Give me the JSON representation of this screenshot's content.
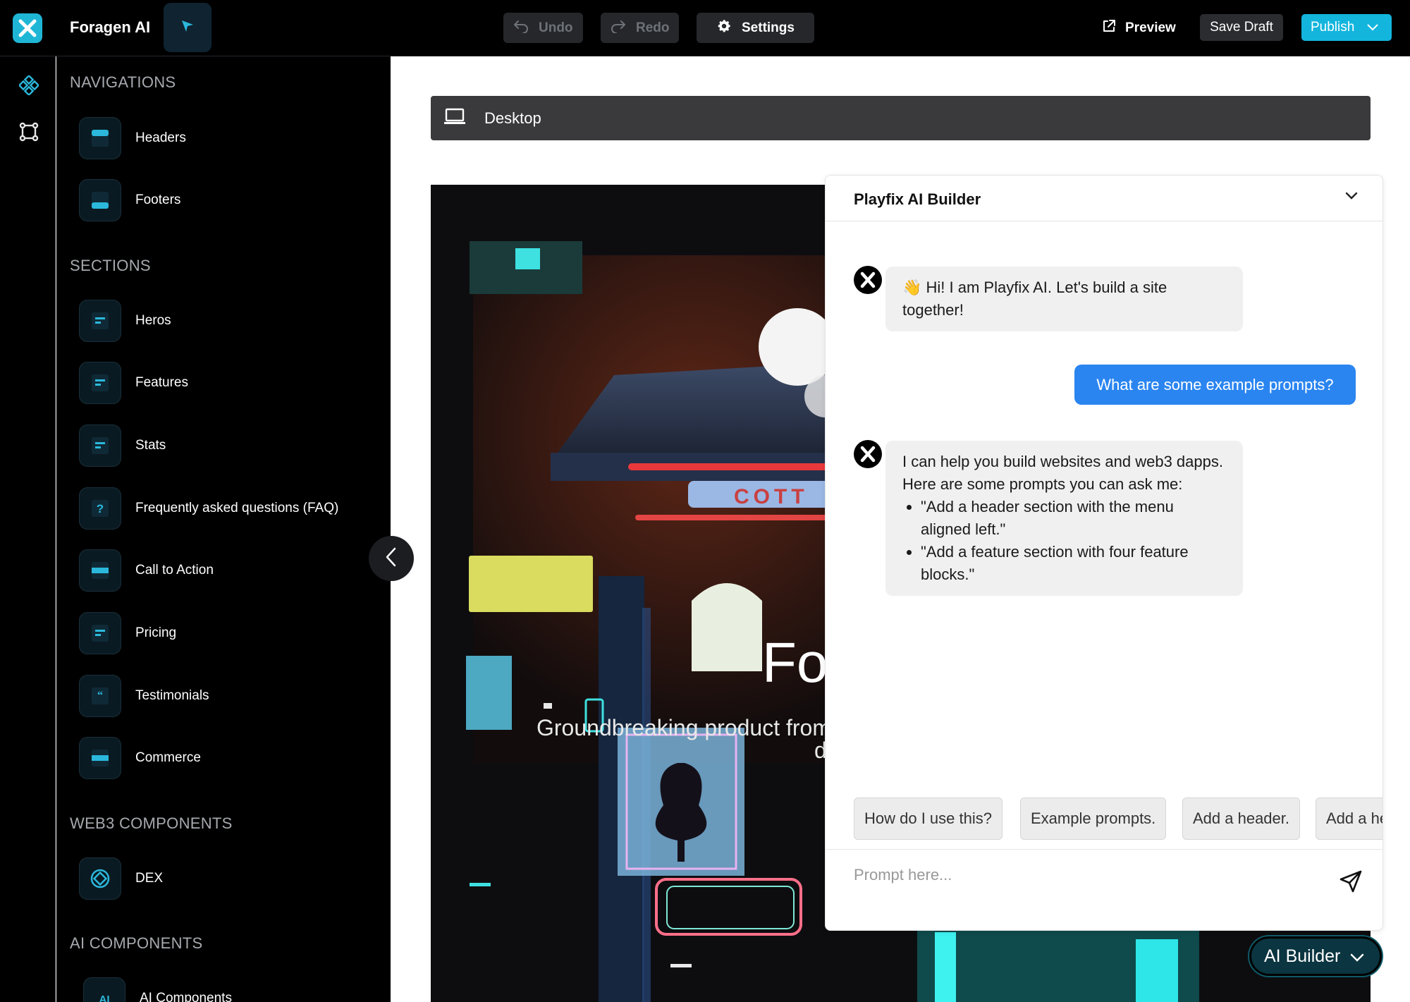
{
  "topbar": {
    "app_title": "Foragen AI",
    "undo_label": "Undo",
    "redo_label": "Redo",
    "settings_label": "Settings",
    "preview_label": "Preview",
    "save_draft_label": "Save Draft",
    "publish_label": "Publish"
  },
  "sidebar": {
    "sections": [
      {
        "title": "NAVIGATIONS",
        "items": [
          {
            "label": "Headers"
          },
          {
            "label": "Footers"
          }
        ]
      },
      {
        "title": "SECTIONS",
        "items": [
          {
            "label": "Heros"
          },
          {
            "label": "Features"
          },
          {
            "label": "Stats"
          },
          {
            "label": "Frequently asked questions (FAQ)"
          },
          {
            "label": "Call to Action"
          },
          {
            "label": "Pricing"
          },
          {
            "label": "Testimonials"
          },
          {
            "label": "Commerce"
          }
        ]
      },
      {
        "title": "WEB3 COMPONENTS",
        "items": [
          {
            "label": "DEX"
          }
        ]
      },
      {
        "title": "AI COMPONENTS",
        "items": [
          {
            "label": "AI Components"
          }
        ]
      }
    ]
  },
  "canvas": {
    "device_label": "Desktop",
    "hero_title": "Fo",
    "hero_subtitle": "Groundbreaking product from",
    "hero_subtitle_cont": "d"
  },
  "chat": {
    "title": "Playfix AI Builder",
    "messages": [
      {
        "role": "ai",
        "text": "👋 Hi! I am Playfix AI. Let's build a site together!"
      },
      {
        "role": "user",
        "text": "What are some example prompts?"
      },
      {
        "role": "ai",
        "text": "I can help you build websites and web3 dapps. Here are some prompts you can ask me:",
        "bullets": [
          "\"Add a header section with the menu aligned left.\"",
          "\"Add a feature section with four feature blocks.\""
        ]
      }
    ],
    "suggestions": [
      "How do I use this?",
      "Example prompts.",
      "Add a header.",
      "Add a hero."
    ],
    "input_placeholder": "Prompt here..."
  },
  "ai_builder_label": "AI Builder",
  "colors": {
    "accent": "#13b5dd",
    "topbar_bg": "#000000",
    "sidebar_bg": "#000000",
    "user_bubble": "#2a85f0",
    "ai_bubble": "#f0f0f0"
  }
}
